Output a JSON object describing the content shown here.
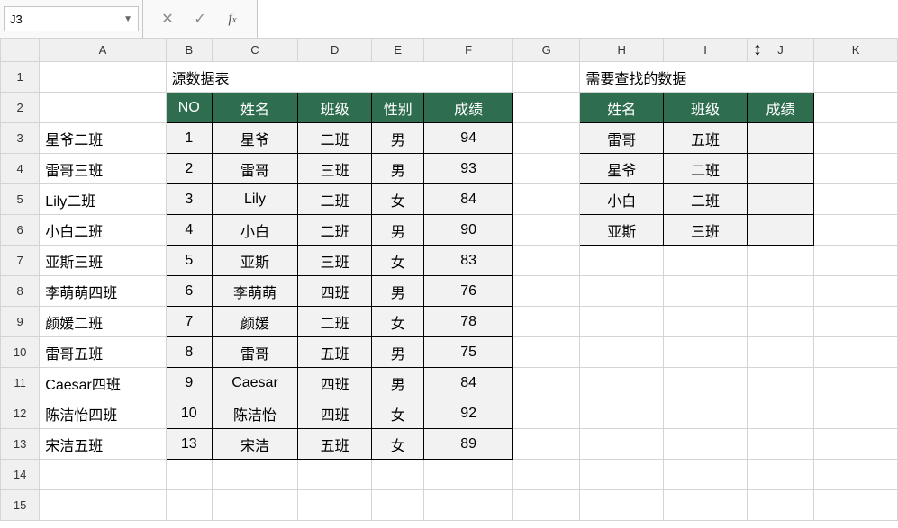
{
  "name_box": "J3",
  "formula_bar": "",
  "columns": [
    "A",
    "B",
    "C",
    "D",
    "E",
    "F",
    "G",
    "H",
    "I",
    "J",
    "K"
  ],
  "row_labels": [
    "1",
    "2",
    "3",
    "4",
    "5",
    "6",
    "7",
    "8",
    "9",
    "10",
    "11",
    "12",
    "13",
    "14",
    "15"
  ],
  "titles": {
    "source": "源数据表",
    "lookup": "需要查找的数据"
  },
  "source_table": {
    "headers": [
      "NO",
      "姓名",
      "班级",
      "性别",
      "成绩"
    ],
    "rows": [
      {
        "concat": "星爷二班",
        "no": "1",
        "name": "星爷",
        "class": "二班",
        "gender": "男",
        "score": "94"
      },
      {
        "concat": "雷哥三班",
        "no": "2",
        "name": "雷哥",
        "class": "三班",
        "gender": "男",
        "score": "93"
      },
      {
        "concat": "Lily二班",
        "no": "3",
        "name": "Lily",
        "class": "二班",
        "gender": "女",
        "score": "84"
      },
      {
        "concat": "小白二班",
        "no": "4",
        "name": "小白",
        "class": "二班",
        "gender": "男",
        "score": "90"
      },
      {
        "concat": "亚斯三班",
        "no": "5",
        "name": "亚斯",
        "class": "三班",
        "gender": "女",
        "score": "83"
      },
      {
        "concat": "李萌萌四班",
        "no": "6",
        "name": "李萌萌",
        "class": "四班",
        "gender": "男",
        "score": "76"
      },
      {
        "concat": "颜媛二班",
        "no": "7",
        "name": "颜媛",
        "class": "二班",
        "gender": "女",
        "score": "78"
      },
      {
        "concat": "雷哥五班",
        "no": "8",
        "name": "雷哥",
        "class": "五班",
        "gender": "男",
        "score": "75"
      },
      {
        "concat": "Caesar四班",
        "no": "9",
        "name": "Caesar",
        "class": "四班",
        "gender": "男",
        "score": "84"
      },
      {
        "concat": "陈洁怡四班",
        "no": "10",
        "name": "陈洁怡",
        "class": "四班",
        "gender": "女",
        "score": "92"
      },
      {
        "concat": "宋洁五班",
        "no": "13",
        "name": "宋洁",
        "class": "五班",
        "gender": "女",
        "score": "89"
      }
    ]
  },
  "lookup_table": {
    "headers": [
      "姓名",
      "班级",
      "成绩"
    ],
    "rows": [
      {
        "name": "雷哥",
        "class": "五班",
        "score": ""
      },
      {
        "name": "星爷",
        "class": "二班",
        "score": ""
      },
      {
        "name": "小白",
        "class": "二班",
        "score": ""
      },
      {
        "name": "亚斯",
        "class": "三班",
        "score": ""
      }
    ]
  },
  "cursor_icon": "↕"
}
